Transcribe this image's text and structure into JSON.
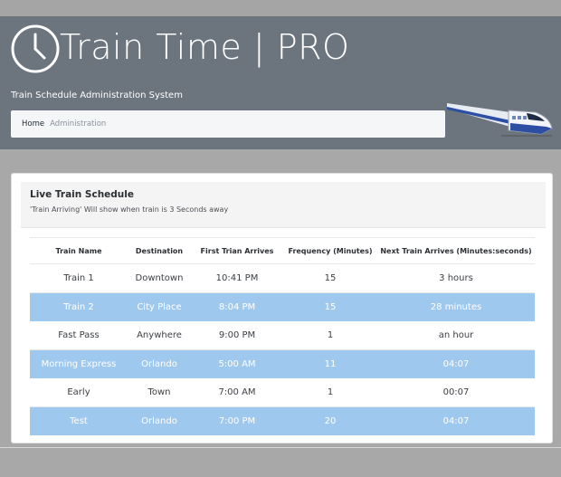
{
  "header": {
    "title": "Train Time | PRO",
    "subtitle": "Train Schedule Administration System",
    "breadcrumb": {
      "home": "Home",
      "admin": "Administration"
    }
  },
  "schedule": {
    "title": "Live Train Schedule",
    "note": "'Train Arriving' Will show when train is 3 Seconds away",
    "columns": [
      "Train Name",
      "Destination",
      "First Trian Arrives",
      "Frequency (Minutes)",
      "Next Train Arrives (Minutes:seconds)"
    ],
    "rows": [
      {
        "name": "Train 1",
        "destination": "Downtown",
        "first": "10:41 PM",
        "frequency": "15",
        "next": "3 hours",
        "highlight": false
      },
      {
        "name": "Train 2",
        "destination": "City Place",
        "first": "8:04 PM",
        "frequency": "15",
        "next": "28 minutes",
        "highlight": true
      },
      {
        "name": "Fast Pass",
        "destination": "Anywhere",
        "first": "9:00 PM",
        "frequency": "1",
        "next": "an hour",
        "highlight": false
      },
      {
        "name": "Morning Express",
        "destination": "Orlando",
        "first": "5:00 AM",
        "frequency": "11",
        "next": "04:07",
        "highlight": true
      },
      {
        "name": "Early",
        "destination": "Town",
        "first": "7:00 AM",
        "frequency": "1",
        "next": "00:07",
        "highlight": false
      },
      {
        "name": "Test",
        "destination": "Orlando",
        "first": "7:00 PM",
        "frequency": "20",
        "next": "04:07",
        "highlight": true
      }
    ]
  },
  "colors": {
    "header_bg": "#6c747d",
    "highlight_row": "#9fc8ef"
  },
  "icons": [
    "clock-icon",
    "bullet-train-icon"
  ]
}
